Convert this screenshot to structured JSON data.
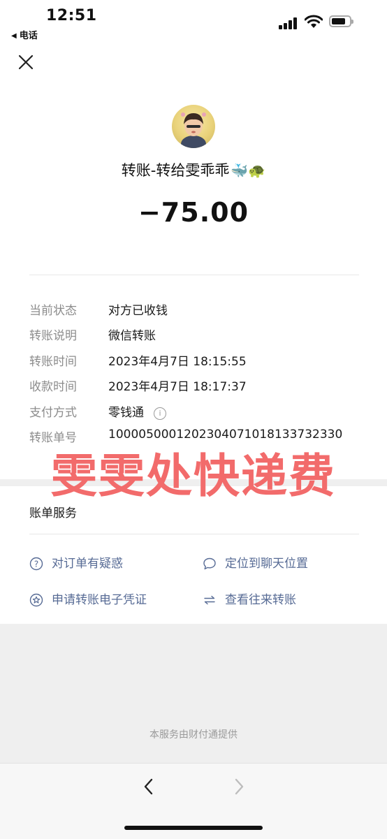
{
  "status_bar": {
    "time": "12:51",
    "back_app_label": "电话",
    "icons": [
      "cellular-signal-icon",
      "wifi-icon",
      "battery-icon"
    ]
  },
  "header": {
    "close_icon": "close-icon"
  },
  "transfer": {
    "title": "转账-转给雯乖乖",
    "title_emoji": "🐳🐢",
    "amount": "−75.00"
  },
  "details": [
    {
      "label": "当前状态",
      "value": "对方已收钱"
    },
    {
      "label": "转账说明",
      "value": "微信转账"
    },
    {
      "label": "转账时间",
      "value": "2023年4月7日 18:15:55"
    },
    {
      "label": "收款时间",
      "value": "2023年4月7日 18:17:37"
    },
    {
      "label": "支付方式",
      "value": "零钱通"
    },
    {
      "label": "转账单号",
      "value": "100005000120230407101813373233​0"
    }
  ],
  "watermark": "雯雯处快递费",
  "bill_service": {
    "title": "账单服务",
    "items": [
      {
        "label": "对订单有疑惑",
        "icon": "question-circle-icon"
      },
      {
        "label": "定位到聊天位置",
        "icon": "chat-bubble-icon"
      },
      {
        "label": "申请转账电子凭证",
        "icon": "star-circle-icon"
      },
      {
        "label": "查看往来转账",
        "icon": "swap-arrows-icon"
      }
    ]
  },
  "footer": {
    "text": "本服务由财付通提供"
  },
  "toolbar": {
    "back_icon": "chevron-left-icon",
    "forward_icon": "chevron-right-icon"
  },
  "colors": {
    "link_blue": "#576b95",
    "label_gray": "#8c8c8c",
    "watermark_red": "#f26b6b",
    "band_gray": "#efefef"
  }
}
